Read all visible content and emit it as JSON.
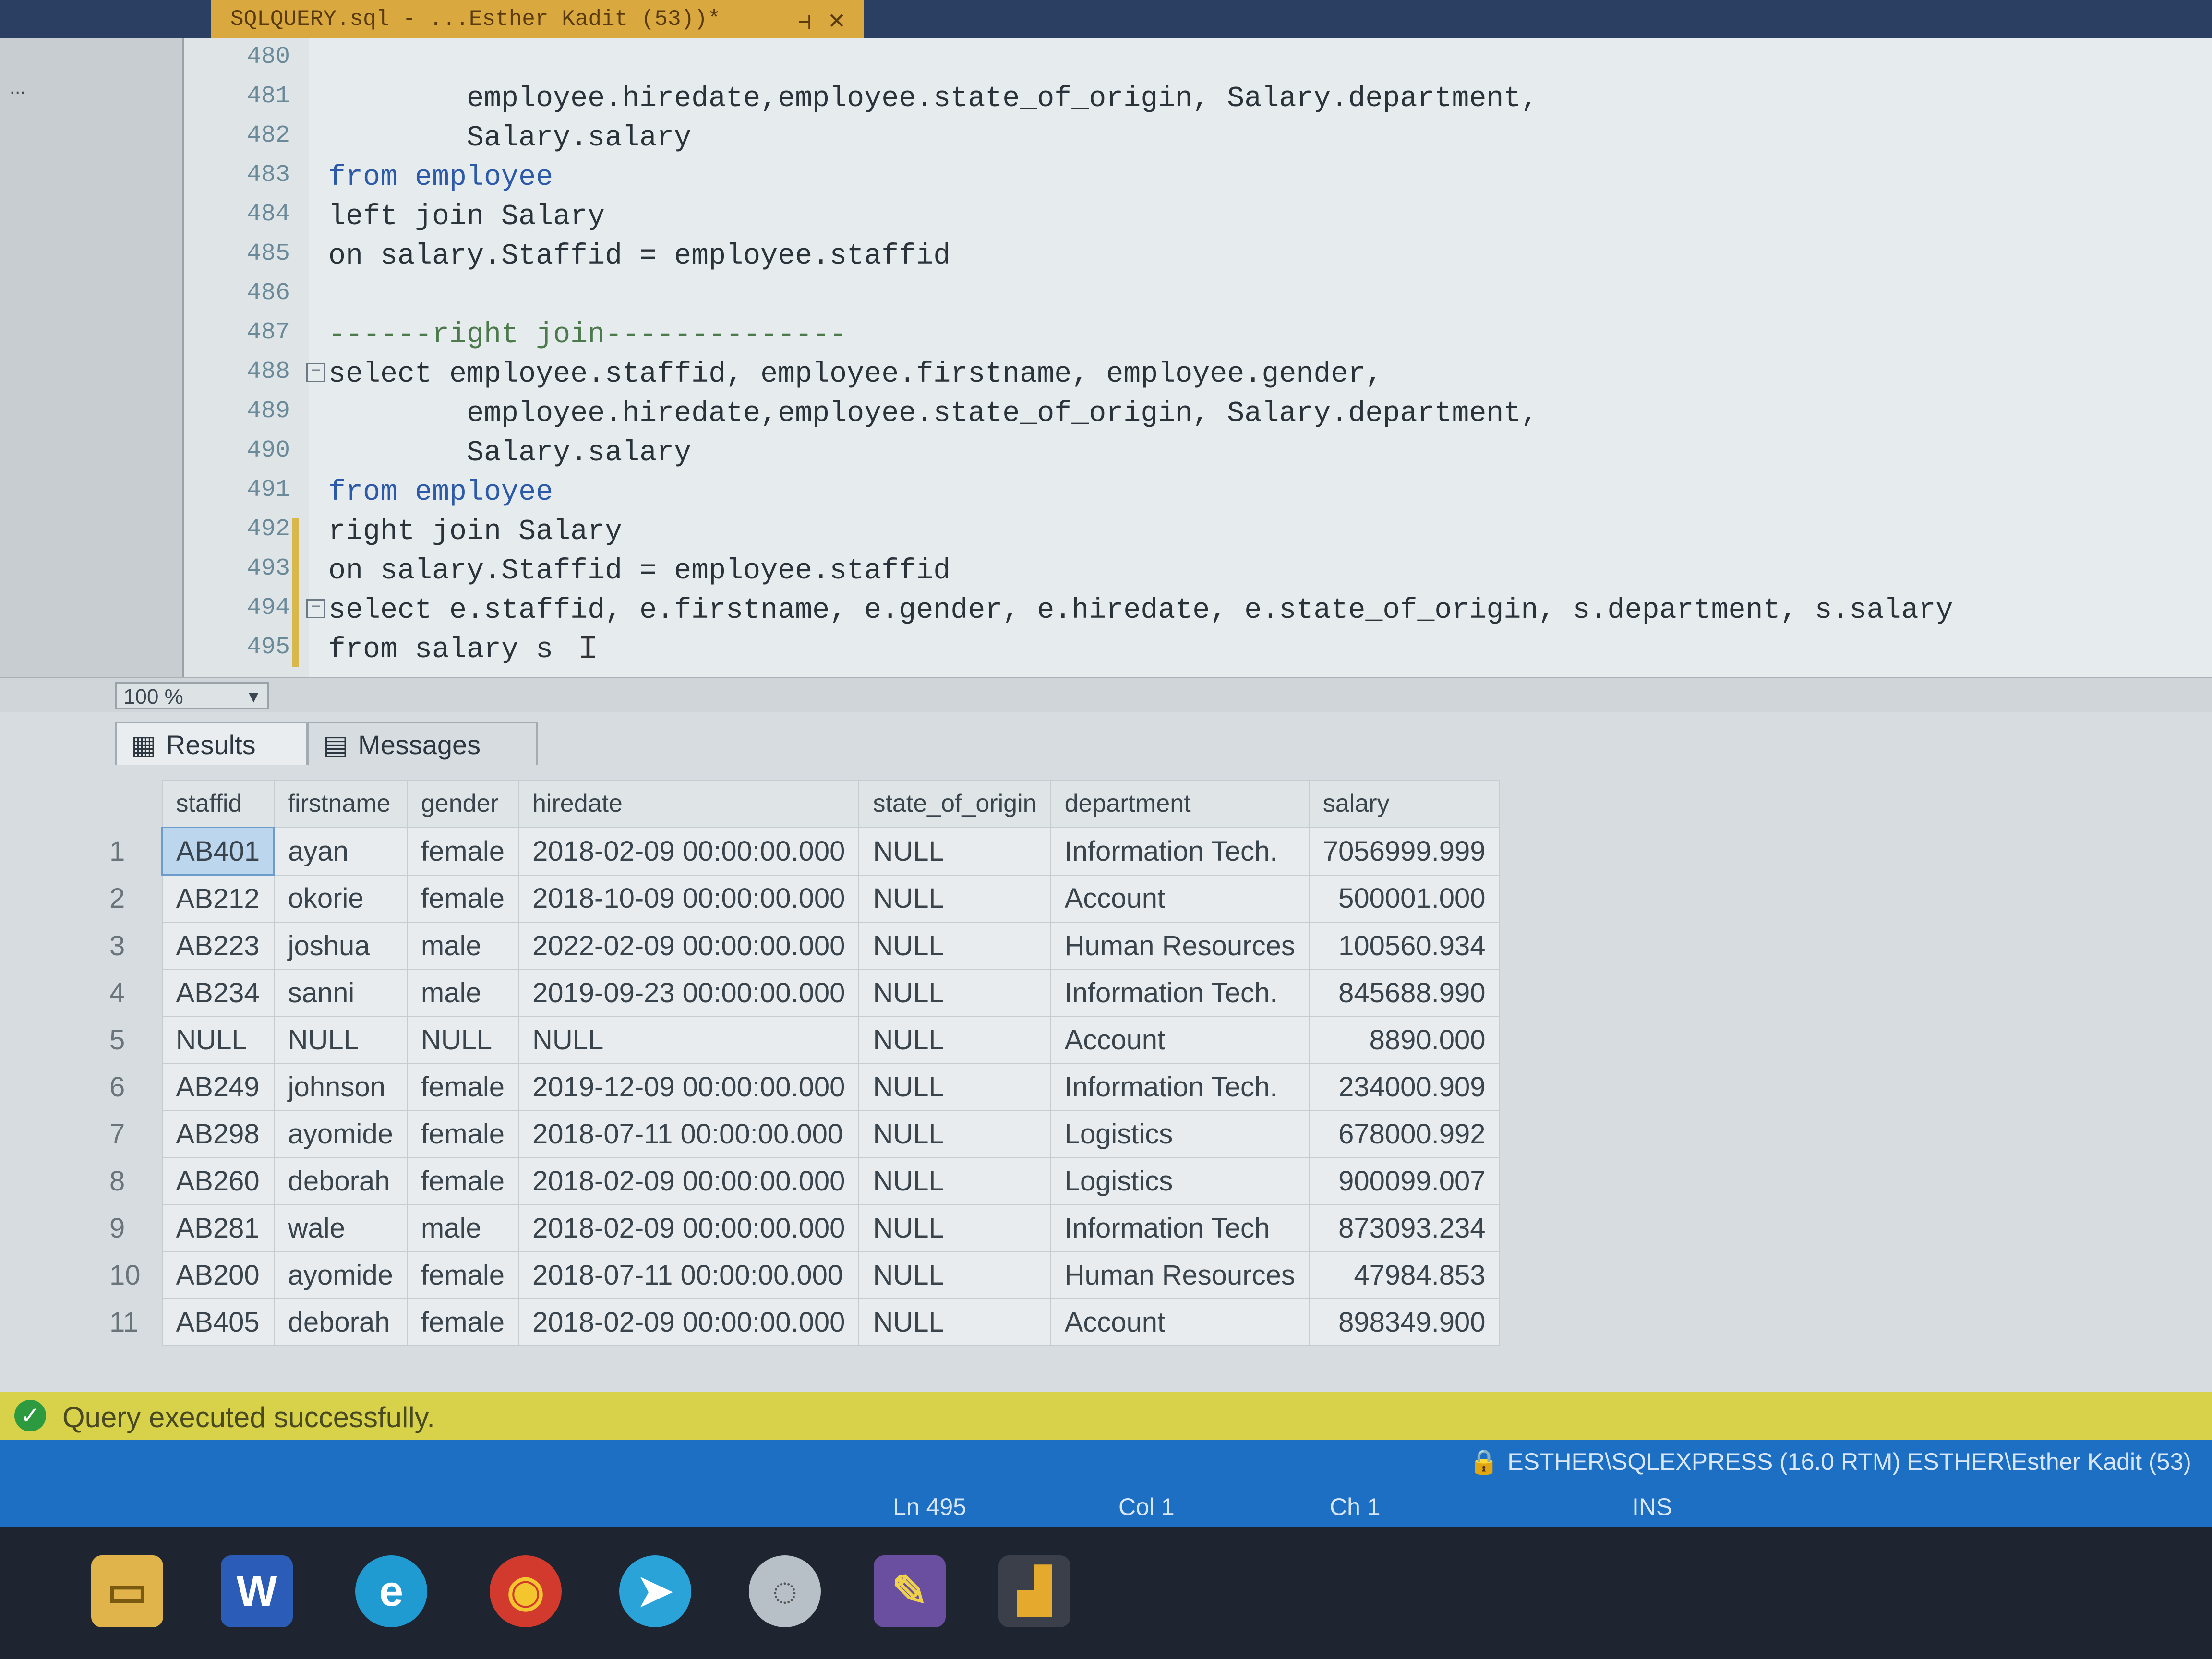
{
  "document_tab": {
    "title": "SQLQUERY.sql - ...Esther Kadit (53))*",
    "pin": "⊣",
    "close": "✕"
  },
  "object_explorer": {
    "server_node": "..."
  },
  "editor": {
    "lines": [
      {
        "no": "480",
        "code": ""
      },
      {
        "no": "481",
        "code": "        employee.hiredate,employee.state_of_origin, Salary.department,"
      },
      {
        "no": "482",
        "code": "        Salary.salary"
      },
      {
        "no": "483",
        "code": "from employee"
      },
      {
        "no": "484",
        "code": "left join Salary"
      },
      {
        "no": "485",
        "code": "on salary.Staffid = employee.staffid"
      },
      {
        "no": "486",
        "code": ""
      },
      {
        "no": "487",
        "code": "------right join--------------"
      },
      {
        "no": "488",
        "code": "select employee.staffid, employee.firstname, employee.gender,"
      },
      {
        "no": "489",
        "code": "        employee.hiredate,employee.state_of_origin, Salary.department,"
      },
      {
        "no": "490",
        "code": "        Salary.salary"
      },
      {
        "no": "491",
        "code": "from employee"
      },
      {
        "no": "492",
        "code": "right join Salary"
      },
      {
        "no": "493",
        "code": "on salary.Staffid = employee.staffid"
      },
      {
        "no": "494",
        "code": "select e.staffid, e.firstname, e.gender, e.hiredate, e.state_of_origin, s.department, s.salary"
      },
      {
        "no": "495",
        "code": "from salary s"
      }
    ]
  },
  "zoom": {
    "value": "100 %"
  },
  "results": {
    "tabs": [
      {
        "label": "Results"
      },
      {
        "label": "Messages"
      }
    ],
    "columns": [
      "staffid",
      "firstname",
      "gender",
      "hiredate",
      "state_of_origin",
      "department",
      "salary"
    ],
    "rows": [
      [
        "1",
        "AB401",
        "ayan",
        "female",
        "2018-02-09 00:00:00.000",
        "NULL",
        "Information Tech.",
        "7056999.999"
      ],
      [
        "2",
        "AB212",
        "okorie",
        "female",
        "2018-10-09 00:00:00.000",
        "NULL",
        "Account",
        "500001.000"
      ],
      [
        "3",
        "AB223",
        "joshua",
        "male",
        "2022-02-09 00:00:00.000",
        "NULL",
        "Human Resources",
        "100560.934"
      ],
      [
        "4",
        "AB234",
        "sanni",
        "male",
        "2019-09-23 00:00:00.000",
        "NULL",
        "Information Tech.",
        "845688.990"
      ],
      [
        "5",
        "NULL",
        "NULL",
        "NULL",
        "NULL",
        "NULL",
        "Account",
        "8890.000"
      ],
      [
        "6",
        "AB249",
        "johnson",
        "female",
        "2019-12-09 00:00:00.000",
        "NULL",
        "Information Tech.",
        "234000.909"
      ],
      [
        "7",
        "AB298",
        "ayomide",
        "female",
        "2018-07-11 00:00:00.000",
        "NULL",
        "Logistics",
        "678000.992"
      ],
      [
        "8",
        "AB260",
        "deborah",
        "female",
        "2018-02-09 00:00:00.000",
        "NULL",
        "Logistics",
        "900099.007"
      ],
      [
        "9",
        "AB281",
        "wale",
        "male",
        "2018-02-09 00:00:00.000",
        "NULL",
        "Information Tech",
        "873093.234"
      ],
      [
        "10",
        "AB200",
        "ayomide",
        "female",
        "2018-07-11 00:00:00.000",
        "NULL",
        "Human Resources",
        "47984.853"
      ],
      [
        "11",
        "AB405",
        "deborah",
        "female",
        "2018-02-09 00:00:00.000",
        "NULL",
        "Account",
        "898349.900"
      ]
    ]
  },
  "status_message": "Query executed successfully.",
  "status_bar": {
    "connection": "ESTHER\\SQLEXPRESS (16.0 RTM)   ESTHER\\Esther Kadit (53)",
    "ln": "Ln 495",
    "col": "Col 1",
    "ch": "Ch 1",
    "ins": "INS"
  },
  "colors": {
    "accent": "#1d6fc4",
    "keyword": "#2c5aa8",
    "status_ok": "#2e9a3f",
    "doc_tab": "#d9a83f"
  }
}
